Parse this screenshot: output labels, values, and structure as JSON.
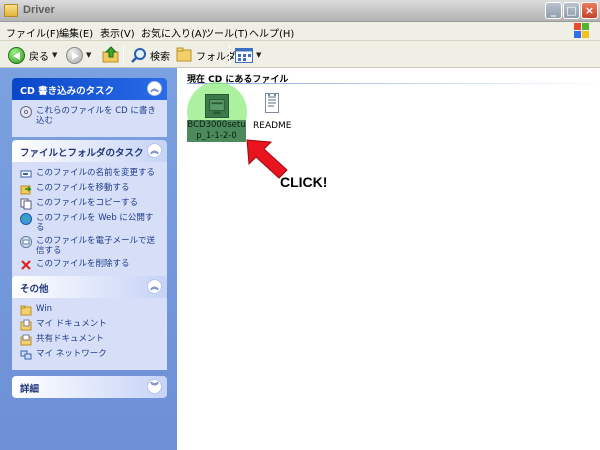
{
  "window": {
    "title": "Driver"
  },
  "menubar": {
    "items": [
      "ファイル(F)",
      "編集(E)",
      "表示(V)",
      "お気に入り(A)",
      "ツール(T)",
      "ヘルプ(H)"
    ]
  },
  "toolbar": {
    "back_label": "戻る",
    "search_label": "検索",
    "folders_label": "フォルダ"
  },
  "left_pane": {
    "cd_tasks": {
      "title": "CD 書き込みのタスク",
      "items": [
        {
          "label": "これらのファイルを CD に書き込む",
          "icon": "cd-write-icon"
        }
      ]
    },
    "file_tasks": {
      "title": "ファイルとフォルダのタスク",
      "items": [
        {
          "label": "このファイルの名前を変更する",
          "icon": "rename-icon"
        },
        {
          "label": "このファイルを移動する",
          "icon": "move-icon"
        },
        {
          "label": "このファイルをコピーする",
          "icon": "copy-icon"
        },
        {
          "label": "このファイルを Web に公開する",
          "icon": "web-publish-icon"
        },
        {
          "label": "このファイルを電子メールで送信する",
          "icon": "email-icon"
        },
        {
          "label": "このファイルを削除する",
          "icon": "delete-icon"
        }
      ]
    },
    "other_places": {
      "title": "その他",
      "items": [
        {
          "label": "Win",
          "icon": "folder-icon"
        },
        {
          "label": "マイ ドキュメント",
          "icon": "my-documents-icon"
        },
        {
          "label": "共有ドキュメント",
          "icon": "shared-documents-icon"
        },
        {
          "label": "マイ ネットワーク",
          "icon": "network-icon"
        }
      ]
    },
    "details": {
      "title": "詳細"
    }
  },
  "main": {
    "section_title": "現在 CD にあるファイル",
    "files": [
      {
        "name_line1": "BCD3000setu",
        "name_line2": "p_1-1-2-0",
        "selected": true,
        "icon": "setup-exe-icon"
      },
      {
        "name": "README",
        "selected": false,
        "icon": "text-document-icon"
      }
    ],
    "annotation": "CLICK!"
  },
  "colors": {
    "task_pane_bg": "#6d8fd6",
    "panel_body": "#d6dff7",
    "primary_header": "#0a47c8",
    "highlight_circle": "#87eb78",
    "arrow": "#e8141e"
  }
}
